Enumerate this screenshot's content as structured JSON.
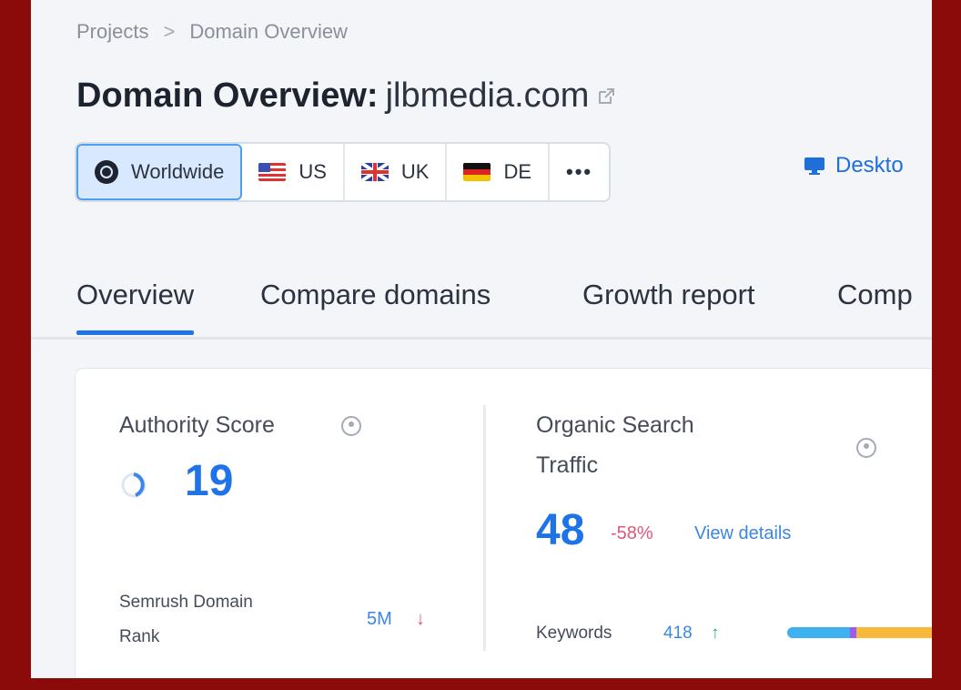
{
  "breadcrumb": {
    "items": [
      "Projects",
      "Domain Overview"
    ],
    "separator": ">"
  },
  "title": {
    "prefix": "Domain Overview:",
    "domain": "jlbmedia.com"
  },
  "databases": {
    "items": [
      {
        "label": "Worldwide",
        "icon": "globe-icon",
        "active": true
      },
      {
        "label": "US",
        "icon": "us-flag-icon"
      },
      {
        "label": "UK",
        "icon": "uk-flag-icon"
      },
      {
        "label": "DE",
        "icon": "de-flag-icon"
      },
      {
        "label": "•••",
        "icon": "more-icon"
      }
    ]
  },
  "device": {
    "label": "Deskto",
    "icon": "monitor-icon"
  },
  "tabs": [
    "Overview",
    "Compare domains",
    "Growth report",
    "Comp"
  ],
  "authority": {
    "label": "Authority Score",
    "value": "19",
    "rank_label_1": "Semrush Domain",
    "rank_label_2": "Rank",
    "rank_value": "5M",
    "rank_trend": "↓"
  },
  "organic": {
    "label_1": "Organic Search",
    "label_2": "Traffic",
    "value": "48",
    "change": "-58%",
    "details_link": "View details",
    "keywords_label": "Keywords",
    "keywords_value": "418",
    "keywords_trend": "↑"
  },
  "colors": {
    "accent": "#1e73e8",
    "negative": "#e0567a",
    "positive": "#2fb67c",
    "frame": "#8b0b0b",
    "kw_segments": [
      "#3fb0f0",
      "#9c5cf0",
      "#f6b93b",
      "#2fd07a"
    ]
  }
}
